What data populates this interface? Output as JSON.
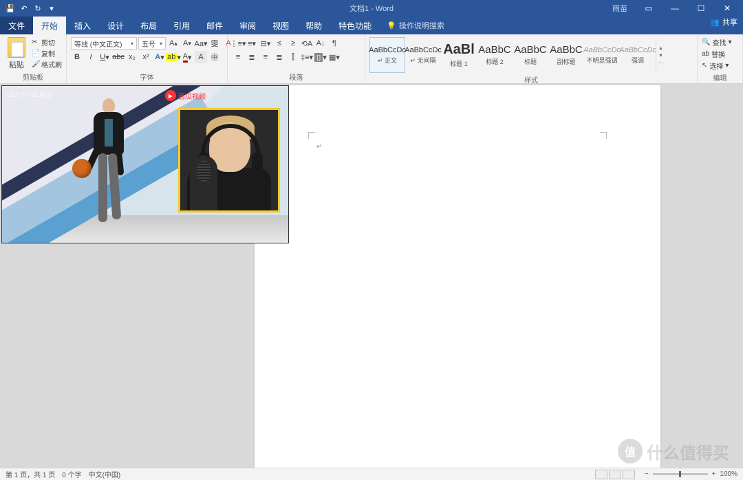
{
  "title": "文档1 - Word",
  "user": "雨苗",
  "share": "共享",
  "tabs": {
    "file": "文件",
    "home": "开始",
    "insert": "插入",
    "design": "设计",
    "layout": "布局",
    "references": "引用",
    "mail": "邮件",
    "review": "审阅",
    "view": "视图",
    "help": "帮助",
    "special": "特色功能",
    "tell": "操作说明搜索"
  },
  "clipboard": {
    "paste": "粘贴",
    "cut": "剪切",
    "copy": "复制",
    "painter": "格式刷",
    "label": "剪贴板"
  },
  "font": {
    "family": "等线 (中文正文)",
    "size": "五号",
    "label": "字体"
  },
  "paragraph": {
    "label": "段落"
  },
  "styles": {
    "label": "样式",
    "items": [
      {
        "prev": "AaBbCcDc",
        "name": "正文",
        "cls": ""
      },
      {
        "prev": "AaBbCcDc",
        "name": "无间隔",
        "cls": ""
      },
      {
        "prev": "AaBl",
        "name": "标题 1",
        "cls": "big"
      },
      {
        "prev": "AaBbC",
        "name": "标题 2",
        "cls": "med"
      },
      {
        "prev": "AaBbC",
        "name": "标题",
        "cls": "med"
      },
      {
        "prev": "AaBbC",
        "name": "副标题",
        "cls": "med"
      },
      {
        "prev": "AaBbCcDc",
        "name": "不明显强调",
        "cls": "grey"
      },
      {
        "prev": "AaBbCcDc",
        "name": "强调",
        "cls": "grey"
      }
    ]
  },
  "editing": {
    "find": "查找",
    "replace": "替换",
    "select": "选择",
    "label": "编辑"
  },
  "status": {
    "page": "第 1 页，共 1 页",
    "words": "0 个字",
    "lang": "中文(中国)",
    "zoom": "100%"
  },
  "video": {
    "corner": "LE九岁不BL喝血",
    "source": "西瓜视频"
  },
  "watermark": {
    "badge": "值",
    "text": "什么值得买"
  }
}
